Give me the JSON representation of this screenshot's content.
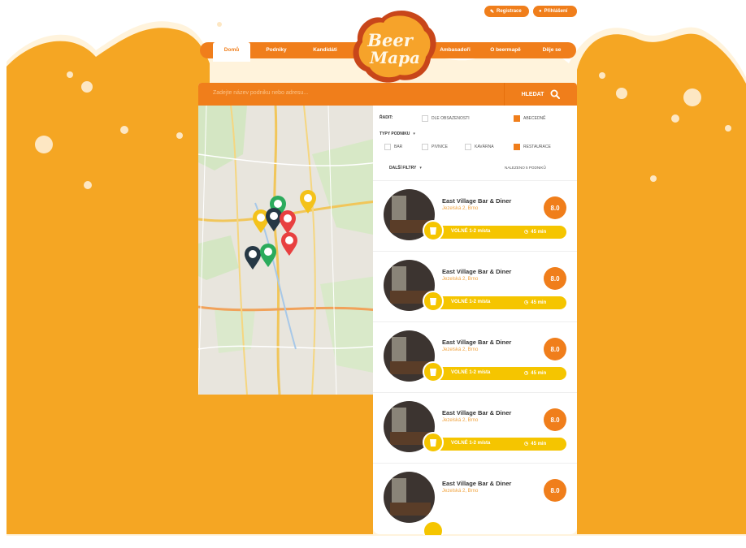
{
  "top_buttons": {
    "register": "Registrace",
    "login": "Přihlášení"
  },
  "logo": {
    "line1": "Beer",
    "line2": "Mapa"
  },
  "nav": {
    "items": [
      "Domů",
      "Podniky",
      "Kandidáti",
      "Ambasadoři",
      "O beermapě",
      "Děje se"
    ]
  },
  "search": {
    "placeholder": "Zadejte název podniku nebo adresu...",
    "button": "HLEDAT"
  },
  "filters": {
    "sort_label": "ŘADIT:",
    "sort_by_rating": "DLE OBSAZENOSTI",
    "sort_alpha": "ABECEDNĚ",
    "types_label": "TYPY PODNIKU",
    "type_bar": "BAR",
    "type_pub": "PIVNICE",
    "type_cafe": "KAVÁRNA",
    "type_restaurant": "RESTAURACE",
    "more_filters": "DALŠÍ FILTRY",
    "found": "NALEZENO 5 PODNIKŮ"
  },
  "venues": [
    {
      "name": "East Village Bar & Diner",
      "address": "Jezelská 2, Brno",
      "score": "8.0",
      "free": "VOLNÉ 1-2 místa",
      "time": "45 min"
    },
    {
      "name": "East Village Bar & Diner",
      "address": "Jezelská 2, Brno",
      "score": "8.0",
      "free": "VOLNÉ 1-2 místa",
      "time": "45 min"
    },
    {
      "name": "East Village Bar & Diner",
      "address": "Jezelská 2, Brno",
      "score": "8.0",
      "free": "VOLNÉ 1-2 místa",
      "time": "45 min"
    },
    {
      "name": "East Village Bar & Diner",
      "address": "Jezelská 2, Brno",
      "score": "8.0",
      "free": "VOLNÉ 1-2 místa",
      "time": "45 min"
    },
    {
      "name": "East Village Bar & Diner",
      "address": "Jezelská 2, Brno",
      "score": "8.0"
    }
  ],
  "colors": {
    "accent": "#f07e1b",
    "beer": "#f5a623",
    "yellow": "#f5c500",
    "foam": "#fff7e6"
  }
}
